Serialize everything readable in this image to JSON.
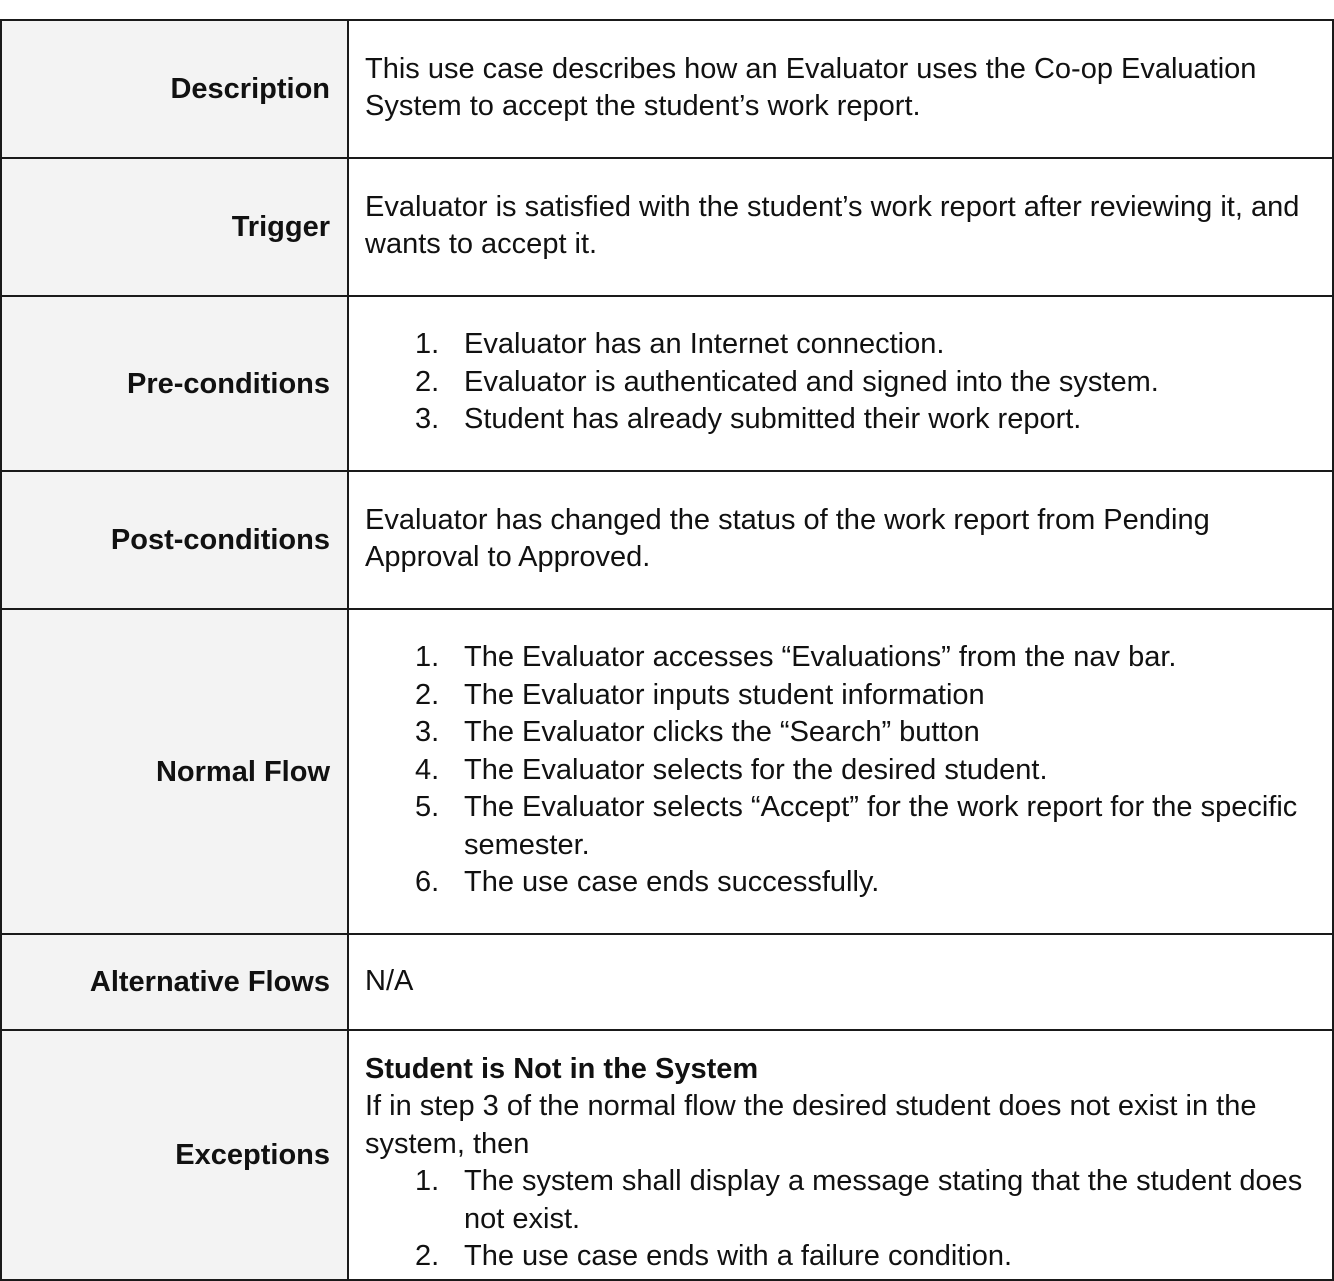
{
  "rows": {
    "description": {
      "label": "Description",
      "text": "This use case describes how an Evaluator uses the Co-op Evaluation System to accept the student’s work report."
    },
    "trigger": {
      "label": "Trigger",
      "text": "Evaluator is satisfied with the student’s work report after reviewing it, and wants to accept it."
    },
    "preconditions": {
      "label": "Pre-conditions",
      "items": [
        {
          "num": "1.",
          "text": "Evaluator has an Internet connection."
        },
        {
          "num": "2.",
          "text": "Evaluator is authenticated and signed into the system."
        },
        {
          "num": "3.",
          "text": "Student has already submitted their work report."
        }
      ]
    },
    "postconditions": {
      "label": "Post-conditions",
      "text": "Evaluator has changed the status of the work report from Pending Approval to Approved."
    },
    "normal_flow": {
      "label": "Normal Flow",
      "items": [
        {
          "num": "1.",
          "text": "The Evaluator accesses “Evaluations” from the nav bar."
        },
        {
          "num": "2.",
          "text": "The Evaluator inputs student information"
        },
        {
          "num": "3.",
          "text": "The Evaluator clicks the “Search” button"
        },
        {
          "num": "4.",
          "text": "The Evaluator selects for the desired student."
        },
        {
          "num": "5.",
          "text": "The Evaluator selects “Accept” for the work report for the specific semester."
        },
        {
          "num": "6.",
          "text": "The use case ends successfully."
        }
      ]
    },
    "alternative_flows": {
      "label": "Alternative Flows",
      "text": "N/A"
    },
    "exceptions": {
      "label": "Exceptions",
      "title": "Student is Not in the System",
      "intro": "If in step 3 of the normal flow the desired student does not exist in the system, then",
      "items": [
        {
          "num": "1.",
          "text": "The system shall display a message stating that the student does not exist."
        },
        {
          "num": "2.",
          "text": "The use case ends with a failure condition."
        }
      ]
    }
  }
}
